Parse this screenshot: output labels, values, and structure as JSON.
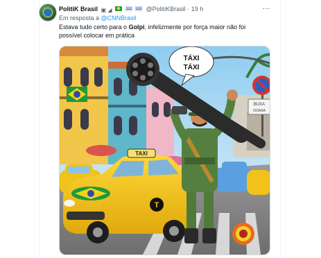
{
  "tweet": {
    "author_name": "PolitiK Brasil",
    "author_badges": "▣ ◢",
    "handle": "@PolitiKBrasil",
    "separator": "·",
    "time": "19 h",
    "more_label": "…",
    "reply_prefix": "Em resposta a",
    "reply_mention": "@CNNBrasil",
    "text_before": "Estava tudo certo para o ",
    "text_bold": "Golpi",
    "text_after": ", infelizmente por força maior não foi possível colocar em prática"
  },
  "image": {
    "speech_line1": "TÁXI",
    "speech_line2": "TÁXI",
    "taxi_sign": "TAXI",
    "street_sign_line1": "BUXA",
    "street_sign_line2": "OOAXA"
  },
  "colors": {
    "link": "#1d9bf0",
    "muted": "#536471",
    "taxi_yellow": "#f2c21b",
    "sky": "#9fd3f0",
    "uniform": "#4f7a3a"
  }
}
